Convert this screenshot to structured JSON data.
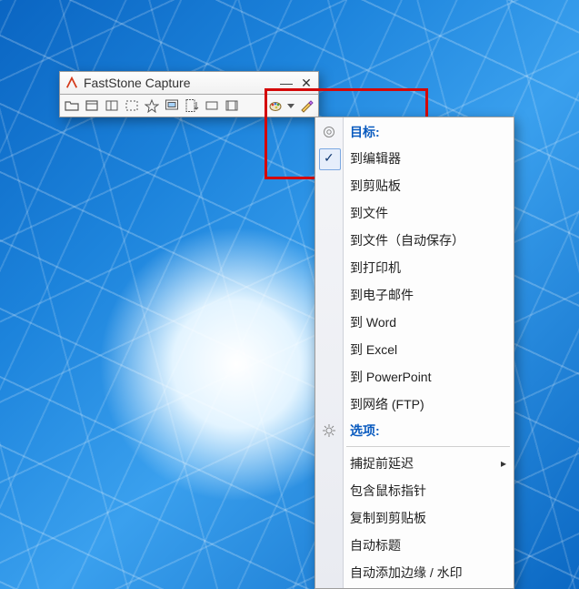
{
  "window": {
    "title": "FastStone Capture"
  },
  "toolbar": {
    "buttons": [
      {
        "name": "open-icon"
      },
      {
        "name": "capture-window-icon"
      },
      {
        "name": "capture-object-icon"
      },
      {
        "name": "capture-rect-icon"
      },
      {
        "name": "capture-freehand-icon"
      },
      {
        "name": "capture-fullscreen-icon"
      },
      {
        "name": "capture-scroll-icon"
      },
      {
        "name": "capture-fixed-icon"
      },
      {
        "name": "record-video-icon"
      }
    ]
  },
  "menu": {
    "header_target": "目标:",
    "items_target": [
      {
        "label": "到编辑器",
        "checked": true
      },
      {
        "label": "到剪贴板"
      },
      {
        "label": "到文件"
      },
      {
        "label": "到文件（自动保存）"
      },
      {
        "label": "到打印机"
      },
      {
        "label": "到电子邮件"
      },
      {
        "label": "到 Word"
      },
      {
        "label": "到 Excel"
      },
      {
        "label": "到 PowerPoint"
      },
      {
        "label": "到网络 (FTP)"
      }
    ],
    "header_options": "选项:",
    "items_options": [
      {
        "label": "捕捉前延迟",
        "submenu": true
      },
      {
        "label": "包含鼠标指针"
      },
      {
        "label": "复制到剪贴板"
      },
      {
        "label": "自动标题"
      },
      {
        "label": "自动添加边缘 / 水印"
      }
    ]
  }
}
